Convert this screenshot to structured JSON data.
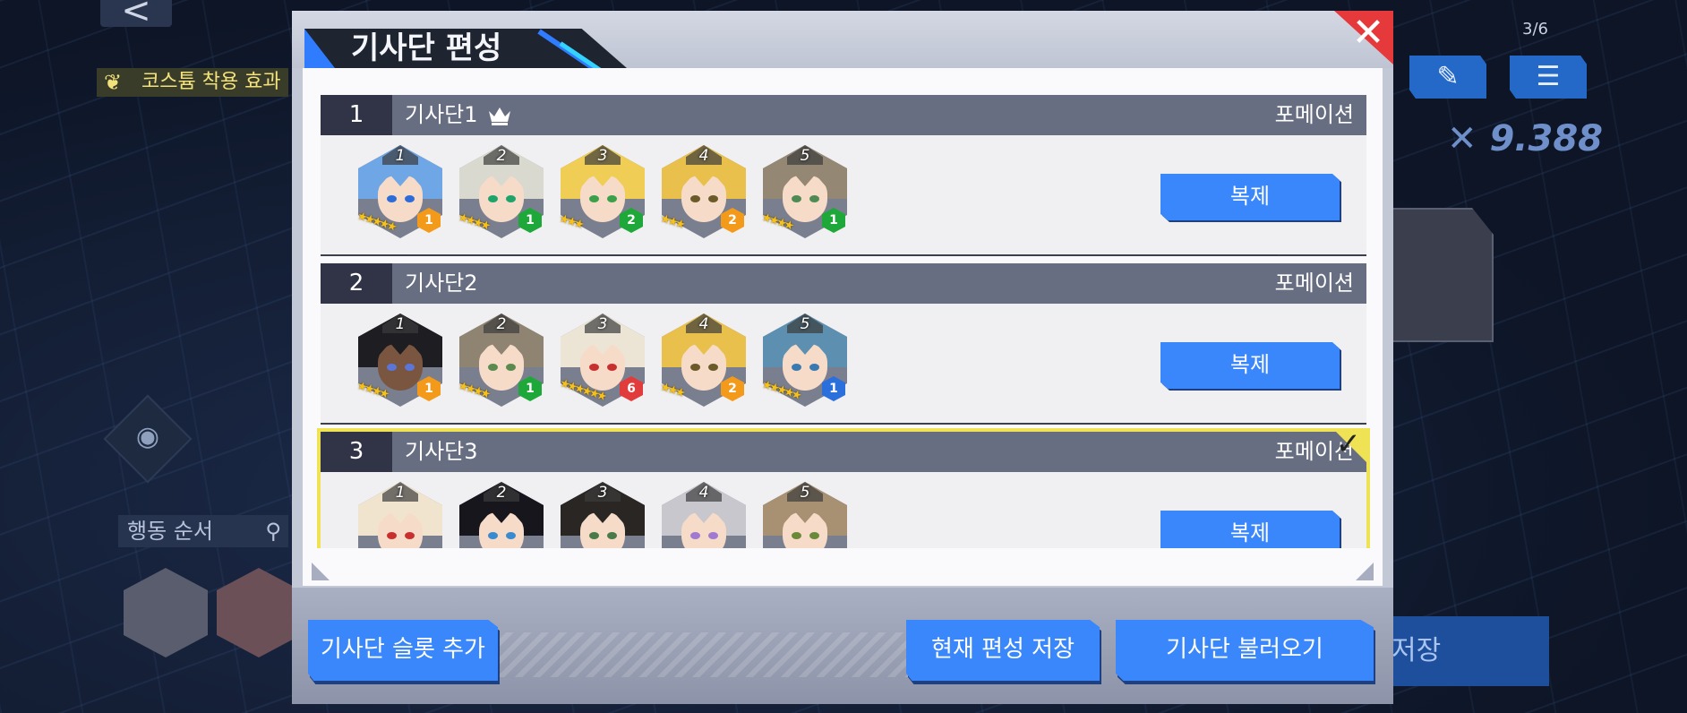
{
  "background": {
    "back_label": "<",
    "costume_label": "코스튬 착용 효과",
    "action_order_label": "행동 순서",
    "page_indicator": "3/6",
    "power_value": "9.388",
    "save_label": "저장"
  },
  "dialog": {
    "title": "기사단 편성",
    "close_label": "✕",
    "formation_label": "포메이션",
    "duplicate_label": "복제",
    "teams": [
      {
        "number": "1",
        "name": "기사단1",
        "leader_icon": "crown-icon",
        "members": [
          {
            "slot": "1",
            "stars": 5,
            "level": "1",
            "level_color": "#f39a1a",
            "hair": "#6fa6e6",
            "eyes": "#2d6bd8"
          },
          {
            "slot": "2",
            "stars": 4,
            "level": "1",
            "level_color": "#1fa83a",
            "hair": "#d9d9cf",
            "eyes": "#1ea36a"
          },
          {
            "slot": "3",
            "stars": 3,
            "level": "2",
            "level_color": "#1fa83a",
            "hair": "#f0cd55",
            "eyes": "#3aa04a"
          },
          {
            "slot": "4",
            "stars": 3,
            "level": "2",
            "level_color": "#f39a1a",
            "hair": "#e9c04c",
            "eyes": "#6b5a2a"
          },
          {
            "slot": "5",
            "stars": 4,
            "level": "1",
            "level_color": "#1fa83a",
            "hair": "#948874",
            "eyes": "#4f8a55"
          }
        ]
      },
      {
        "number": "2",
        "name": "기사단2",
        "members": [
          {
            "slot": "1",
            "stars": 4,
            "level": "1",
            "level_color": "#f39a1a",
            "hair": "#1d1d22",
            "eyes": "#5a76d6"
          },
          {
            "slot": "2",
            "stars": 4,
            "level": "1",
            "level_color": "#1fa83a",
            "hair": "#8f8472",
            "eyes": "#5a8a4e"
          },
          {
            "slot": "3",
            "stars": 6,
            "level": "6",
            "level_color": "#e23b3b",
            "hair": "#ece5d6",
            "eyes": "#c83030"
          },
          {
            "slot": "4",
            "stars": 3,
            "level": "2",
            "level_color": "#f39a1a",
            "hair": "#e9c04c",
            "eyes": "#6b5a2a"
          },
          {
            "slot": "5",
            "stars": 5,
            "level": "1",
            "level_color": "#2b6fdc",
            "hair": "#5d8fb0",
            "eyes": "#3a7ab0"
          }
        ]
      },
      {
        "number": "3",
        "name": "기사단3",
        "selected": true,
        "members": [
          {
            "slot": "1",
            "hair": "#f0e4cf",
            "eyes": "#c83030"
          },
          {
            "slot": "2",
            "hair": "#16161c",
            "eyes": "#3a8ad0"
          },
          {
            "slot": "3",
            "hair": "#2a2624",
            "eyes": "#4a7a4a"
          },
          {
            "slot": "4",
            "hair": "#c9c7ce",
            "eyes": "#a07ad0"
          },
          {
            "slot": "5",
            "hair": "#a89072",
            "eyes": "#6a8a3a"
          }
        ]
      }
    ],
    "footer": {
      "add_slot_label": "기사단 슬롯 추가",
      "save_current_label": "현재 편성 저장",
      "load_label": "기사단 불러오기"
    }
  },
  "colors": {
    "accent_blue": "#3a87fb",
    "close_red": "#e5393b",
    "selected_yellow": "#f0e255",
    "bar_gray": "#686e82",
    "number_dark": "#303446"
  }
}
